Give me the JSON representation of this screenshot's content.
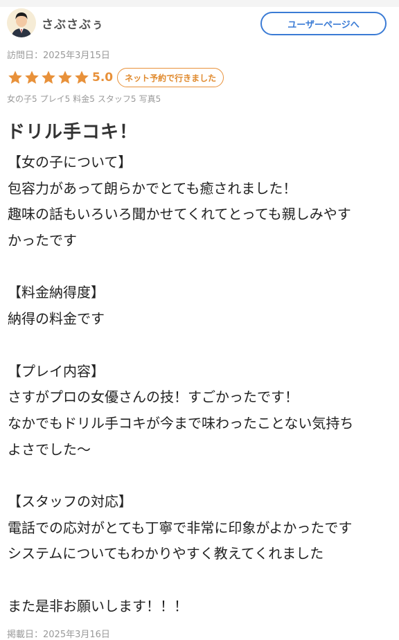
{
  "user": {
    "name": "さぶさぶぅ",
    "profile_button": "ユーザーページへ"
  },
  "review": {
    "visit_date": "訪問日：2025年3月15日",
    "stars": 5,
    "score": "5.0",
    "booking_badge": "ネット予約で行きました",
    "sub_ratings": [
      "女の子5",
      "プレイ5",
      "料金5",
      "スタッフ5",
      "写真5"
    ],
    "title": "ドリル手コキ！",
    "lines": [
      "【女の子について】",
      "包容力があって朗らかでとても癒されました！",
      "趣味の話もいろいろ聞かせてくれてとっても親しみやす",
      "かったです",
      "",
      "【料金納得度】",
      "納得の料金です",
      "",
      "【プレイ内容】",
      "さすがプロの女優さんの技！すごかったです！",
      "なかでもドリル手コキが今まで味わったことない気持ち",
      "よさでした～",
      "",
      "【スタッフの対応】",
      "電話での応対がとても丁寧で非常に印象がよかったです",
      "システムについてもわかりやすく教えてくれました",
      "",
      "また是非お願いします！！！"
    ],
    "posted_date": "掲載日：2025年3月16日"
  },
  "colors": {
    "accent_blue": "#3a7bd5",
    "star_orange": "#e8913a",
    "muted_text": "#999999"
  },
  "icons": {
    "avatar": "user-avatar-icon",
    "star": "star-icon"
  }
}
